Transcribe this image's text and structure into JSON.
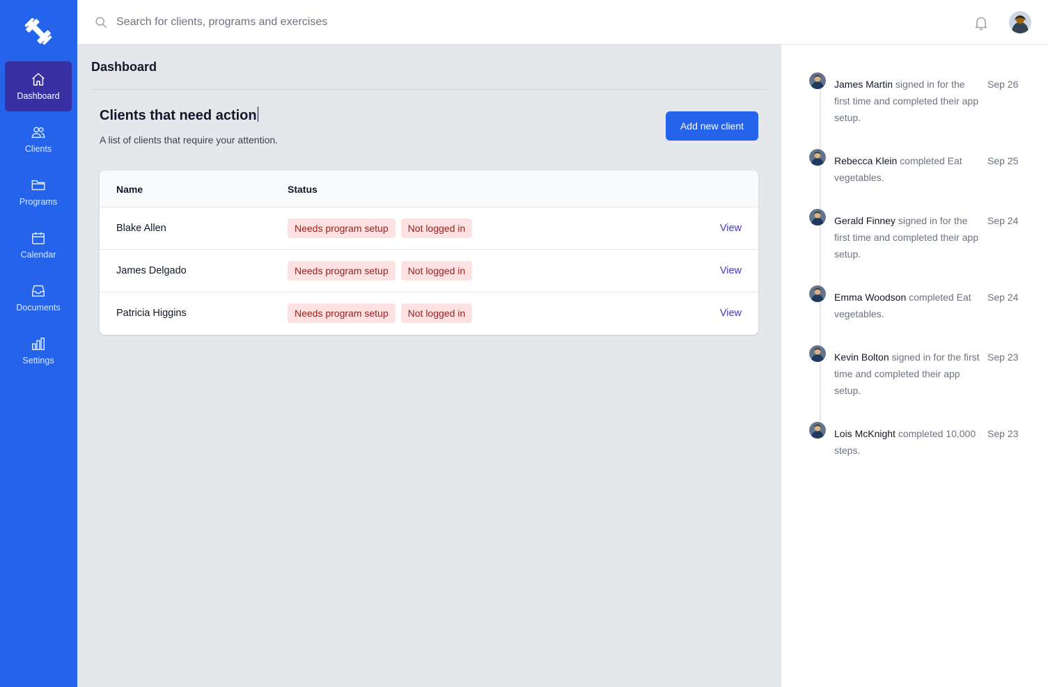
{
  "colors": {
    "sidebar": "#2563eb",
    "sidebar_active": "#3730a3",
    "primary_button": "#2563eb",
    "badge_bg": "#fee2e2",
    "badge_text": "#991b1b",
    "link": "#4338ca"
  },
  "sidebar": {
    "logo_icon": "dumbbell-icon",
    "items": [
      {
        "label": "Dashboard",
        "icon": "home-icon",
        "active": true
      },
      {
        "label": "Clients",
        "icon": "users-icon",
        "active": false
      },
      {
        "label": "Programs",
        "icon": "folder-icon",
        "active": false
      },
      {
        "label": "Calendar",
        "icon": "calendar-icon",
        "active": false
      },
      {
        "label": "Documents",
        "icon": "inbox-icon",
        "active": false
      },
      {
        "label": "Settings",
        "icon": "chart-bar-icon",
        "active": false
      }
    ]
  },
  "search": {
    "placeholder": "Search for clients, programs and exercises",
    "value": ""
  },
  "main": {
    "page_title": "Dashboard",
    "section_title": "Clients that need action",
    "section_subtitle": "A list of clients that require your attention.",
    "add_button": "Add new client",
    "table": {
      "headers": {
        "name": "Name",
        "status": "Status"
      },
      "rows": [
        {
          "name": "Blake Allen",
          "badges": [
            "Needs program setup",
            "Not logged in"
          ],
          "action": "View"
        },
        {
          "name": "James Delgado",
          "badges": [
            "Needs program setup",
            "Not logged in"
          ],
          "action": "View"
        },
        {
          "name": "Patricia Higgins",
          "badges": [
            "Needs program setup",
            "Not logged in"
          ],
          "action": "View"
        }
      ]
    }
  },
  "feed": [
    {
      "name": "James Martin",
      "text": " signed in for the first time and completed their app setup.",
      "date": "Sep 26"
    },
    {
      "name": "Rebecca Klein",
      "text": " completed Eat vegetables.",
      "date": "Sep 25"
    },
    {
      "name": "Gerald Finney",
      "text": " signed in for the first time and completed their app setup.",
      "date": "Sep 24"
    },
    {
      "name": "Emma Woodson",
      "text": " completed Eat vegetables.",
      "date": "Sep 24"
    },
    {
      "name": "Kevin Bolton",
      "text": " signed in for the first time and completed their app setup.",
      "date": "Sep 23"
    },
    {
      "name": "Lois McKnight",
      "text": " completed 10,000 steps.",
      "date": "Sep 23"
    }
  ]
}
